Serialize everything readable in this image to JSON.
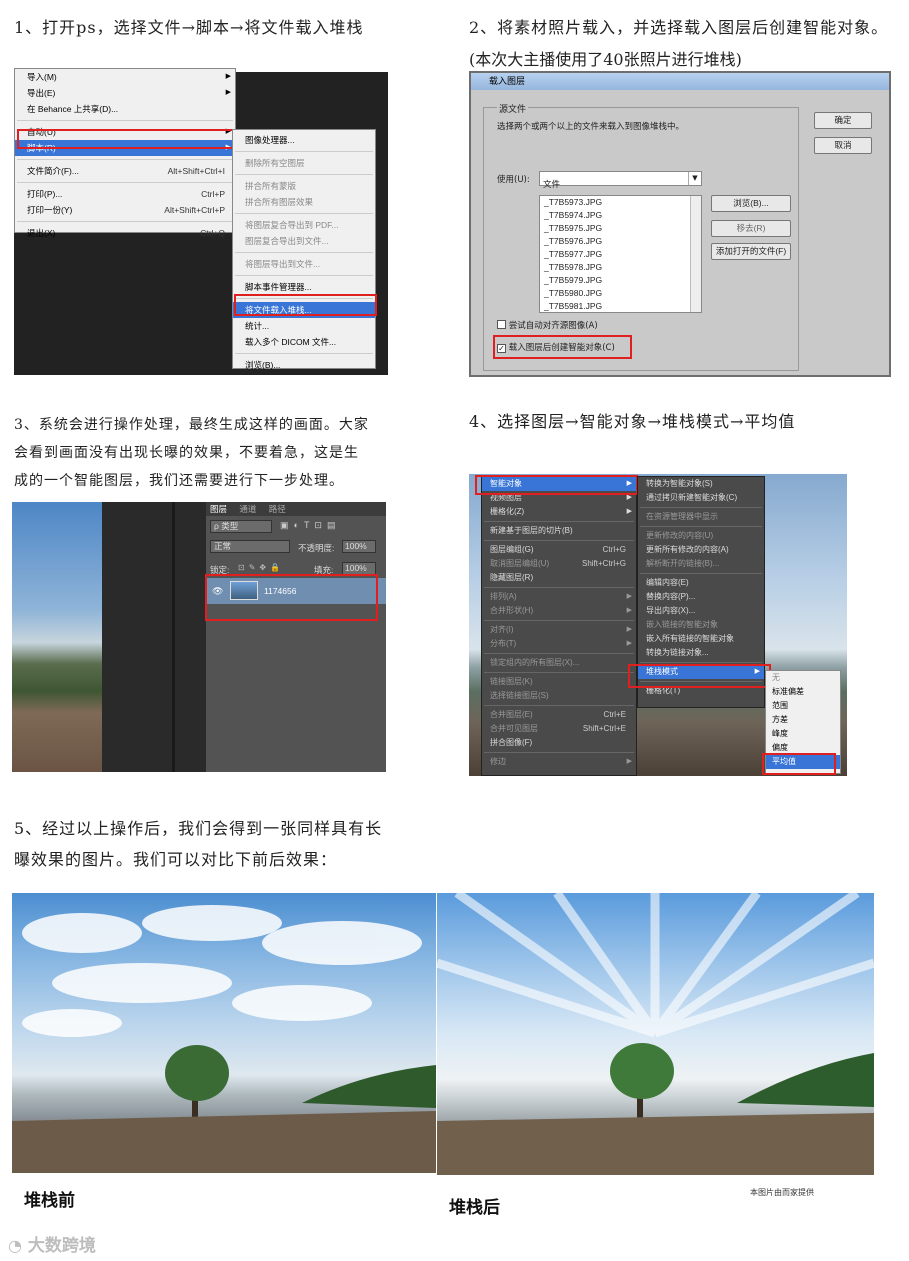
{
  "steps": {
    "s1": "1、打开ps，选择文件→脚本→将文件载入堆栈",
    "s2_line1": "2、将素材照片载入，并选择载入图层后创建智能对象。",
    "s2_line2": "(本次大主播使用了40张照片进行堆栈)",
    "s3_line1": "3、系统会进行操作处理，最终生成这样的画面。大家",
    "s3_line2": "会看到画面没有出现长曝的效果，不要着急，这是生",
    "s3_line3": "成的一个智能图层，我们还需要进行下一步处理。",
    "s4": "4、选择图层→智能对象→堆栈模式→平均值",
    "s5_line1": "5、经过以上操作后，我们会得到一张同样具有长",
    "s5_line2": "曝效果的图片。我们可以对比下前后效果："
  },
  "file_menu": {
    "items": [
      {
        "label": "导入(M)",
        "sc": "",
        "arrow": true
      },
      {
        "label": "导出(E)",
        "sc": "",
        "arrow": true
      },
      {
        "label": "在 Behance 上共享(D)...",
        "sc": ""
      },
      {
        "label": "自动(U)",
        "sc": "",
        "arrow": true
      },
      {
        "label": "脚本(R)",
        "sc": "",
        "arrow": true
      },
      {
        "label": "文件简介(F)...",
        "sc": "Alt+Shift+Ctrl+I"
      },
      {
        "label": "打印(P)...",
        "sc": "Ctrl+P"
      },
      {
        "label": "打印一份(Y)",
        "sc": "Alt+Shift+Ctrl+P"
      },
      {
        "label": "退出(X)",
        "sc": "Ctrl+Q"
      }
    ]
  },
  "script_menu": {
    "items": [
      "图像处理器...",
      "删除所有空图层",
      "拼合所有蒙版",
      "拼合所有图层效果",
      "将图层复合导出到 PDF...",
      "图层复合导出到文件...",
      "将图层导出到文件...",
      "脚本事件管理器...",
      "将文件载入堆栈...",
      "统计...",
      "载入多个 DICOM 文件...",
      "浏览(B)..."
    ]
  },
  "dialog": {
    "title": "载入图层",
    "group": "源文件",
    "desc": "选择两个或两个以上的文件来载入到图像堆栈中。",
    "use_label": "使用(U):",
    "use_value": "文件",
    "files": [
      "_T7B5973.JPG",
      "_T7B5974.JPG",
      "_T7B5975.JPG",
      "_T7B5976.JPG",
      "_T7B5977.JPG",
      "_T7B5978.JPG",
      "_T7B5979.JPG",
      "_T7B5980.JPG",
      "_T7B5981.JPG"
    ],
    "ok": "确定",
    "cancel": "取消",
    "browse": "浏览(B)...",
    "remove": "移去(R)",
    "add_open": "添加打开的文件(F)",
    "auto_align": "尝试自动对齐源图像(A)",
    "smart_obj": "载入图层后创建智能对象(C)"
  },
  "layers_panel": {
    "tabs": [
      "图层",
      "通道",
      "路径"
    ],
    "kind": "ρ 类型",
    "blend": "正常",
    "opacity_label": "不透明度:",
    "opacity": "100%",
    "lock_label": "锁定:",
    "fill_label": "填充:",
    "fill": "100%",
    "layer_name": "1174656"
  },
  "layer_menu": {
    "items": [
      {
        "label": "智能对象",
        "sc": "",
        "arrow": true
      },
      {
        "label": "视频图层",
        "sc": "",
        "arrow": true
      },
      {
        "label": "栅格化(Z)",
        "sc": "",
        "arrow": true
      },
      {
        "label": "新建基于图层的切片(B)",
        "sc": ""
      },
      {
        "label": "图层编组(G)",
        "sc": "Ctrl+G"
      },
      {
        "label": "取消图层编组(U)",
        "sc": "Shift+Ctrl+G"
      },
      {
        "label": "隐藏图层(R)",
        "sc": ""
      },
      {
        "label": "排列(A)",
        "sc": "",
        "arrow": true
      },
      {
        "label": "合并形状(H)",
        "sc": "",
        "arrow": true
      },
      {
        "label": "对齐(I)",
        "sc": "",
        "arrow": true
      },
      {
        "label": "分布(T)",
        "sc": "",
        "arrow": true
      },
      {
        "label": "锁定组内的所有图层(X)...",
        "sc": ""
      },
      {
        "label": "链接图层(K)",
        "sc": ""
      },
      {
        "label": "选择链接图层(S)",
        "sc": ""
      },
      {
        "label": "合并图层(E)",
        "sc": "Ctrl+E"
      },
      {
        "label": "合并可见图层",
        "sc": "Shift+Ctrl+E"
      },
      {
        "label": "拼合图像(F)",
        "sc": ""
      },
      {
        "label": "修边",
        "sc": "",
        "arrow": true
      }
    ]
  },
  "smart_menu": {
    "items": [
      "转换为智能对象(S)",
      "通过拷贝新建智能对象(C)",
      "在资源管理器中显示",
      "更新修改的内容(U)",
      "更新所有修改的内容(A)",
      "解析断开的链接(B)...",
      "编辑内容(E)",
      "替换内容(P)...",
      "导出内容(X)...",
      "嵌入链接的智能对象",
      "嵌入所有链接的智能对象",
      "转换为链接对象...",
      "堆栈模式",
      "栅格化(T)"
    ]
  },
  "stack_menu": {
    "items": [
      "无",
      "标准偏差",
      "范围",
      "方差",
      "峰度",
      "偏度",
      "平均值"
    ]
  },
  "compare": {
    "before": "堆栈前",
    "after": "堆栈后",
    "credit": "本图片由而家提供"
  },
  "watermark": "大数跨境"
}
